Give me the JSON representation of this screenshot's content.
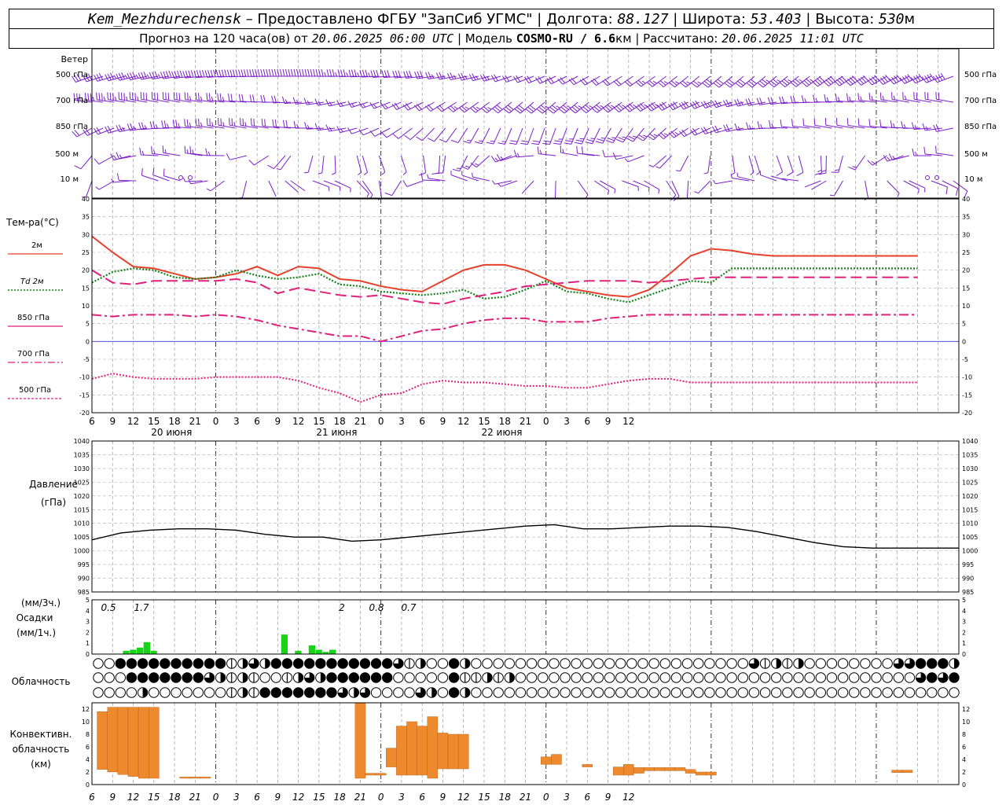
{
  "header": {
    "station": "Kem_Mezhdurechensk",
    "provider_text": " – Предоставлено ФГБУ \"ЗапСиб УГМС\" | ",
    "lon_label": "Долгота: ",
    "lon_value": "88.127",
    "lat_label": " | Широта: ",
    "lat_value": "53.403",
    "alt_label": " | Высота: ",
    "alt_value": "530",
    "alt_unit": "м",
    "forecast_text": "Прогноз на 120 часа(ов) от ",
    "forecast_time": "20.06.2025 06:00 UTC",
    "model_label": "  | Модель ",
    "model_value": "COSMO-RU / 6.6",
    "model_unit": "км",
    "calc_label": " | Рассчитано: ",
    "calc_time": "20.06.2025 11:01 UTC"
  },
  "wind_panel": {
    "title": "Ветер",
    "levels": [
      "500 гПа",
      "700 гПа",
      "850 гПа",
      "500 м",
      "10 м"
    ]
  },
  "temp_panel": {
    "title": "Тем-ра(°С)",
    "legend": [
      {
        "label": "2м",
        "color": "#e8402a",
        "style": "solid"
      },
      {
        "label": "Td 2м",
        "color": "#16821c",
        "style": "dotted"
      },
      {
        "label": "850 гПа",
        "color": "#e0207a",
        "style": "dashed"
      },
      {
        "label": "700 гПа",
        "color": "#e0207a",
        "style": "dashdot"
      },
      {
        "label": "500 гПа",
        "color": "#e0207a",
        "style": "dotted"
      }
    ],
    "ticks": [
      "40",
      "35",
      "30",
      "25",
      "20",
      "15",
      "10",
      "5",
      "0",
      "-5",
      "-10",
      "-15",
      "-20"
    ]
  },
  "time_axis": {
    "labels": [
      "6",
      "9",
      "12",
      "15",
      "18",
      "21",
      "0",
      "3",
      "6",
      "9",
      "12",
      "15",
      "18",
      "21",
      "0",
      "3",
      "6",
      "9",
      "12",
      "15",
      "18",
      "21",
      "0",
      "3",
      "6",
      "9",
      "12"
    ],
    "dates": [
      "20 июня",
      "21 июня",
      "22 июня"
    ]
  },
  "pressure_panel": {
    "title": "Давление",
    "unit": "(гПа)",
    "ticks": [
      "1040",
      "1035",
      "1030",
      "1025",
      "1020",
      "1015",
      "1010",
      "1005",
      "1000",
      "995",
      "990",
      "985"
    ]
  },
  "precip_panel": {
    "unit_top": "(мм/3ч.)",
    "title": "Осадки",
    "unit_bottom": "(мм/1ч.)",
    "ticks": [
      "5",
      "4",
      "3",
      "2",
      "1",
      "0"
    ],
    "annotations": [
      "0.5",
      "1.7",
      "2",
      "0.8",
      "0.7"
    ]
  },
  "cloud_panel": {
    "title": "Облачность"
  },
  "conv_panel": {
    "title_1": "Конвективн.",
    "title_2": "облачность",
    "unit": "(км)",
    "ticks": [
      "12",
      "10",
      "8",
      "6",
      "4",
      "2",
      "0"
    ]
  },
  "colors": {
    "wind": "#7a1fc8",
    "t2m": "#e8402a",
    "td2m": "#16821c",
    "upper": "#e0207a",
    "zero_line": "#3b3bd6",
    "precip": "#18d418",
    "conv": "#ee8a2e"
  },
  "chart_data": [
    {
      "type": "line",
      "name": "temperature",
      "x_hours": [
        0,
        3,
        6,
        9,
        12,
        15,
        18,
        21,
        24,
        27,
        30,
        33,
        36,
        39,
        42,
        45,
        48,
        51,
        54,
        57,
        60,
        63,
        66,
        69,
        72,
        75,
        78,
        81,
        84,
        87,
        90,
        93,
        96,
        99,
        102,
        105,
        108,
        111,
        114,
        117,
        120
      ],
      "ylim": [
        -20,
        40
      ],
      "series": [
        {
          "name": "2м",
          "values": [
            29.5,
            25,
            21,
            20.5,
            19,
            17.5,
            18,
            19,
            21,
            18.5,
            21,
            20.5,
            17.5,
            17,
            15.5,
            14.5,
            14,
            17,
            20,
            21.5,
            21.5,
            20,
            17.5,
            15,
            14,
            13,
            12.5,
            14.5,
            19,
            24,
            26,
            25.5,
            24.5,
            24,
            24,
            24,
            24,
            24,
            24,
            24,
            24
          ]
        },
        {
          "name": "Td 2м",
          "values": [
            16.5,
            19.5,
            20.5,
            20,
            18,
            17.5,
            18,
            20,
            18.5,
            17.5,
            18,
            19,
            16,
            15.5,
            14,
            13.5,
            13,
            13.5,
            14.5,
            12,
            12.5,
            14.5,
            17,
            14,
            13.5,
            12,
            11,
            13,
            15,
            17,
            16.5,
            20.5,
            20.5,
            20.5,
            20.5,
            20.5,
            20.5,
            20.5,
            20.5,
            20.5,
            20.5
          ]
        },
        {
          "name": "850 гПа",
          "values": [
            20,
            16.5,
            16,
            17,
            17,
            17,
            17,
            17.5,
            16.5,
            13.5,
            15,
            14,
            13,
            12.5,
            13,
            12,
            11,
            10.5,
            12,
            13,
            14,
            15.5,
            16,
            16.5,
            17,
            17,
            17,
            16.5,
            17,
            17.5,
            18,
            18,
            18,
            18,
            18,
            18,
            18,
            18,
            18,
            18,
            18
          ]
        },
        {
          "name": "700 гПа",
          "values": [
            7.5,
            7,
            7.5,
            7.5,
            7.5,
            7,
            7.5,
            7,
            6,
            4.5,
            3.5,
            2.5,
            1.5,
            1.5,
            0,
            1.5,
            3,
            3.5,
            5,
            6,
            6.5,
            6.5,
            5.5,
            5.5,
            5.5,
            6.5,
            7,
            7.5,
            7.5,
            7.5,
            7.5,
            7.5,
            7.5,
            7.5,
            7.5,
            7.5,
            7.5,
            7.5,
            7.5,
            7.5,
            7.5
          ]
        },
        {
          "name": "500 гПа",
          "values": [
            -10.5,
            -9,
            -10,
            -10.5,
            -10.5,
            -10.5,
            -10,
            -10,
            -10,
            -10,
            -11,
            -13,
            -14.5,
            -17,
            -15,
            -14.5,
            -12,
            -11,
            -11.5,
            -11.5,
            -12,
            -12.5,
            -12.5,
            -13,
            -13,
            -12,
            -11,
            -10.5,
            -10.5,
            -11.5,
            -11.5,
            -11.5,
            -11.5,
            -11.5,
            -11.5,
            -11.5,
            -11.5,
            -11.5,
            -11.5,
            -11.5,
            -11.5
          ]
        }
      ]
    },
    {
      "type": "line",
      "name": "pressure",
      "x_hours": [
        0,
        3,
        6,
        9,
        12,
        15,
        18,
        21,
        24,
        27,
        30,
        33,
        36,
        39,
        42,
        45,
        48,
        51,
        54,
        57,
        60,
        63,
        66,
        69,
        72,
        75,
        78,
        81,
        84,
        87,
        90
      ],
      "ylim": [
        985,
        1040
      ],
      "series": [
        {
          "name": "Давление",
          "values": [
            1004,
            1006.5,
            1007.5,
            1008,
            1008,
            1007.5,
            1006,
            1005,
            1005,
            1003.5,
            1004,
            1005,
            1006,
            1007,
            1008,
            1009,
            1009.5,
            1008,
            1008,
            1008.5,
            1009,
            1009,
            1008.5,
            1007,
            1005,
            1003,
            1001.5,
            1001,
            1001,
            1001,
            1001
          ]
        }
      ]
    },
    {
      "type": "bar",
      "name": "precipitation",
      "x_hours": [
        4,
        5,
        6,
        7,
        8,
        9,
        27,
        28,
        29,
        30,
        31,
        32,
        33,
        34,
        35,
        36,
        37
      ],
      "ylim": [
        0,
        5
      ],
      "values": [
        0.3,
        0.4,
        0.6,
        1.1,
        0.3,
        0,
        1.8,
        0,
        0.3,
        0,
        0.8,
        0.4,
        0.2,
        0.4,
        0,
        0,
        0
      ]
    },
    {
      "type": "bar",
      "name": "convective_cloud_km",
      "ylim": [
        0,
        13
      ],
      "bars": [
        {
          "x": 1,
          "base": 2.4,
          "top": 11.6
        },
        {
          "x": 2,
          "base": 2.0,
          "top": 12.3
        },
        {
          "x": 3,
          "base": 1.6,
          "top": 12.3
        },
        {
          "x": 4,
          "base": 1.3,
          "top": 12.3
        },
        {
          "x": 5,
          "base": 1.0,
          "top": 12.3
        },
        {
          "x": 6,
          "base": 1.0,
          "top": 12.3
        },
        {
          "x": 9,
          "base": 1.0,
          "top": 1.2
        },
        {
          "x": 10,
          "base": 1.0,
          "top": 1.2
        },
        {
          "x": 11,
          "base": 1.0,
          "top": 1.2
        },
        {
          "x": 26,
          "base": 1.0,
          "top": 13.0
        },
        {
          "x": 27,
          "base": 1.5,
          "top": 1.8
        },
        {
          "x": 28,
          "base": 1.5,
          "top": 1.8
        },
        {
          "x": 29,
          "base": 2.8,
          "top": 5.8
        },
        {
          "x": 30,
          "base": 1.5,
          "top": 9.3
        },
        {
          "x": 31,
          "base": 1.5,
          "top": 10.0
        },
        {
          "x": 32,
          "base": 1.5,
          "top": 9.3
        },
        {
          "x": 33,
          "base": 1.0,
          "top": 10.8
        },
        {
          "x": 34,
          "base": 2.5,
          "top": 8.2
        },
        {
          "x": 35,
          "base": 2.5,
          "top": 8.0
        },
        {
          "x": 36,
          "base": 2.5,
          "top": 8.0
        },
        {
          "x": 44,
          "base": 3.2,
          "top": 4.4
        },
        {
          "x": 45,
          "base": 3.2,
          "top": 4.8
        },
        {
          "x": 48,
          "base": 2.8,
          "top": 3.2
        },
        {
          "x": 51,
          "base": 1.5,
          "top": 2.8
        },
        {
          "x": 52,
          "base": 1.5,
          "top": 3.2
        },
        {
          "x": 53,
          "base": 1.8,
          "top": 2.7
        },
        {
          "x": 54,
          "base": 2.2,
          "top": 2.7
        },
        {
          "x": 55,
          "base": 2.2,
          "top": 2.7
        },
        {
          "x": 56,
          "base": 2.2,
          "top": 2.7
        },
        {
          "x": 57,
          "base": 2.2,
          "top": 2.7
        },
        {
          "x": 58,
          "base": 1.8,
          "top": 2.4
        },
        {
          "x": 59,
          "base": 1.5,
          "top": 2.0
        },
        {
          "x": 60,
          "base": 1.5,
          "top": 2.0
        },
        {
          "x": 78,
          "base": 1.9,
          "top": 2.3
        },
        {
          "x": 79,
          "base": 1.9,
          "top": 2.3
        }
      ]
    }
  ]
}
